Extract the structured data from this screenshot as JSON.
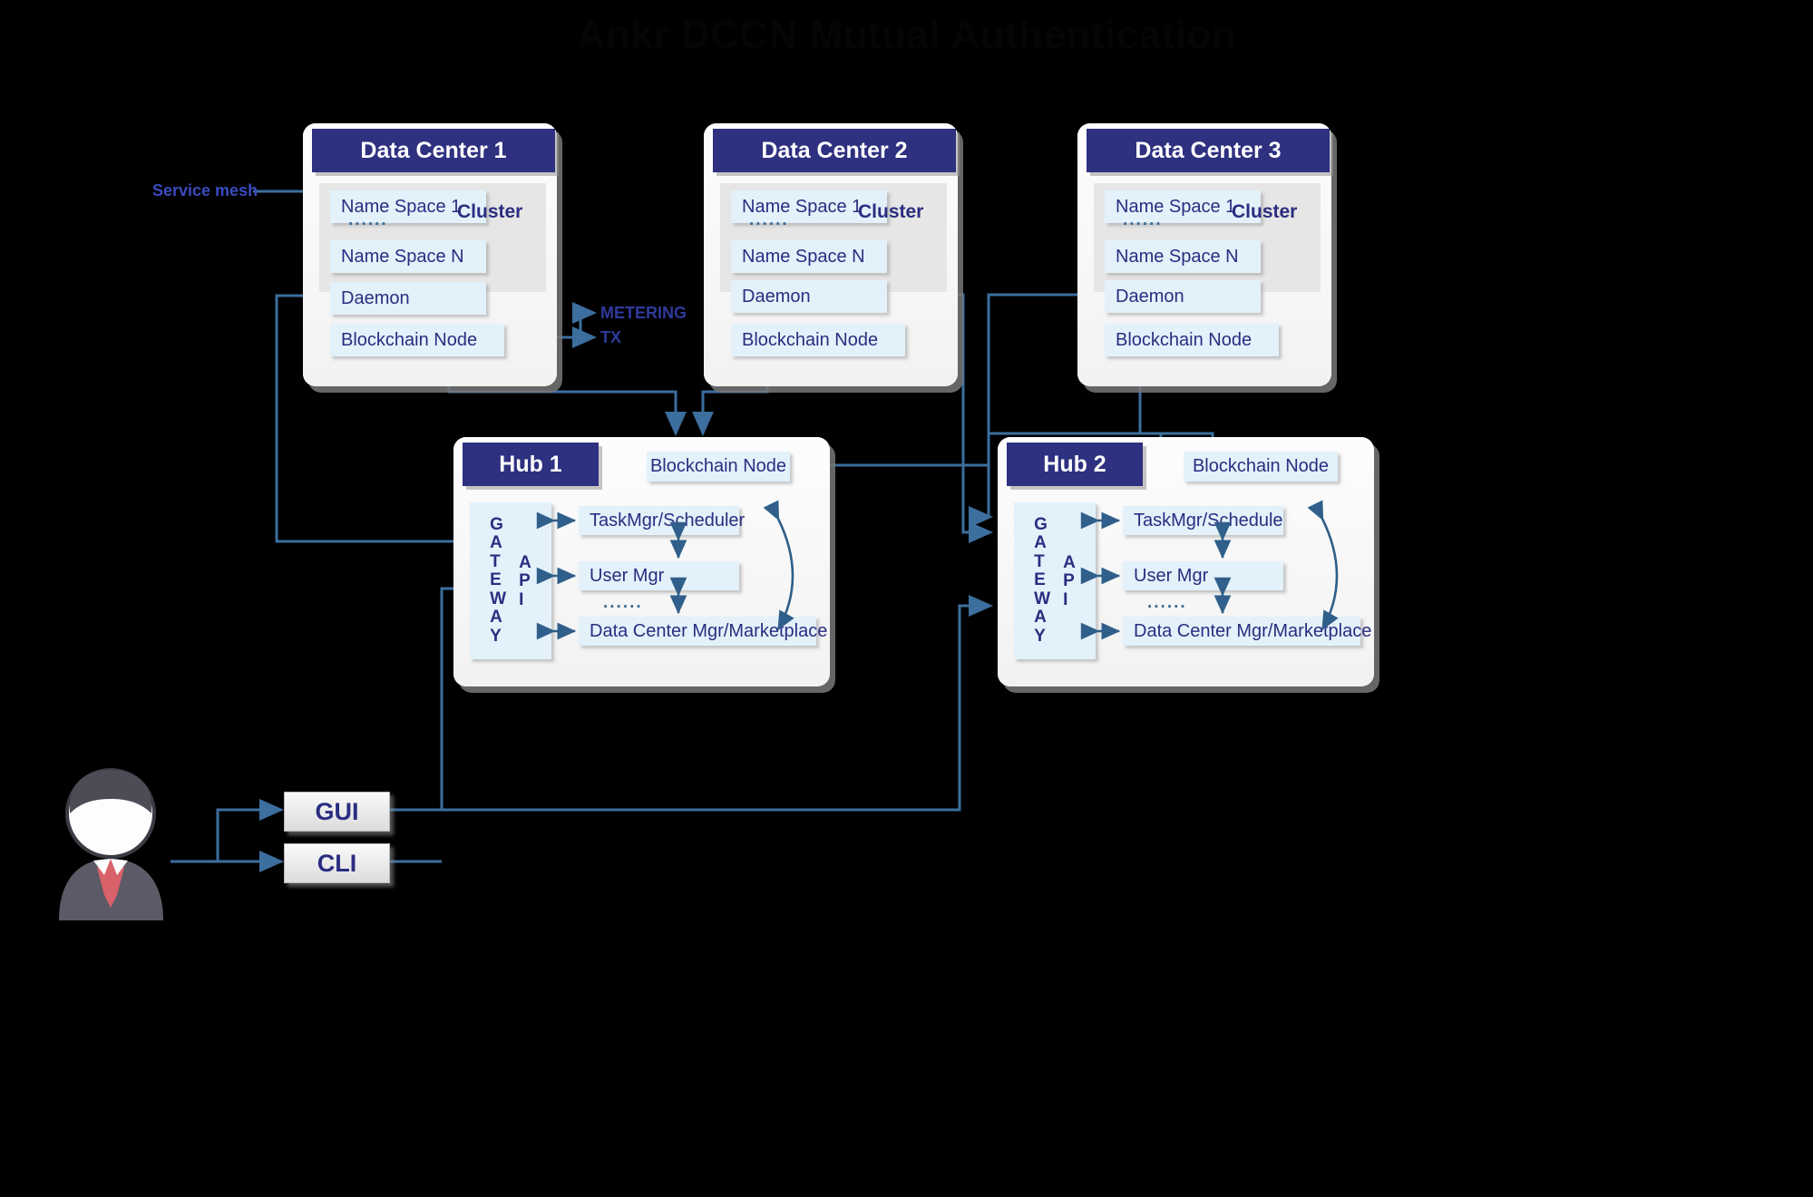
{
  "title": "Ankr DCCN Mutual Authentication",
  "labels": {
    "service_mesh": "Service mesh",
    "metering": "METERING",
    "tx": "TX",
    "cluster": "Cluster",
    "ellipsis": "......"
  },
  "data_centers": [
    {
      "title": "Data Center 1",
      "cluster_label": "Cluster",
      "namespaces": [
        "Name Space 1",
        "Name Space N"
      ],
      "services": [
        "Daemon",
        "Blockchain Node"
      ]
    },
    {
      "title": "Data Center 2",
      "cluster_label": "Cluster",
      "namespaces": [
        "Name Space 1",
        "Name Space N"
      ],
      "services": [
        "Daemon",
        "Blockchain Node"
      ]
    },
    {
      "title": "Data Center 3",
      "cluster_label": "Cluster",
      "namespaces": [
        "Name Space 1",
        "Name Space N"
      ],
      "services": [
        "Daemon",
        "Blockchain Node"
      ]
    }
  ],
  "hubs": [
    {
      "title": "Hub 1",
      "blockchain_node": "Blockchain Node",
      "gateway": "GATEWAY",
      "api": "API",
      "modules": [
        "TaskMgr/Scheduler",
        "User Mgr",
        "Data Center Mgr/Marketplace"
      ],
      "module_ellipsis": "......"
    },
    {
      "title": "Hub 2",
      "blockchain_node": "Blockchain Node",
      "gateway": "GATEWAY",
      "api": "API",
      "modules": [
        "TaskMgr/Schedule",
        "User Mgr",
        "Data Center Mgr/Marketplace"
      ],
      "module_ellipsis": "......"
    }
  ],
  "terminals": [
    {
      "label": "GUI"
    },
    {
      "label": "CLI"
    }
  ],
  "colors": {
    "header_navy": "#2e3080",
    "chip_blue": "#e3f1fa",
    "text_navy": "#2a2d80",
    "wire": "#3c6e9e",
    "background": "#000000",
    "accent_label": "#2f3a9c"
  }
}
